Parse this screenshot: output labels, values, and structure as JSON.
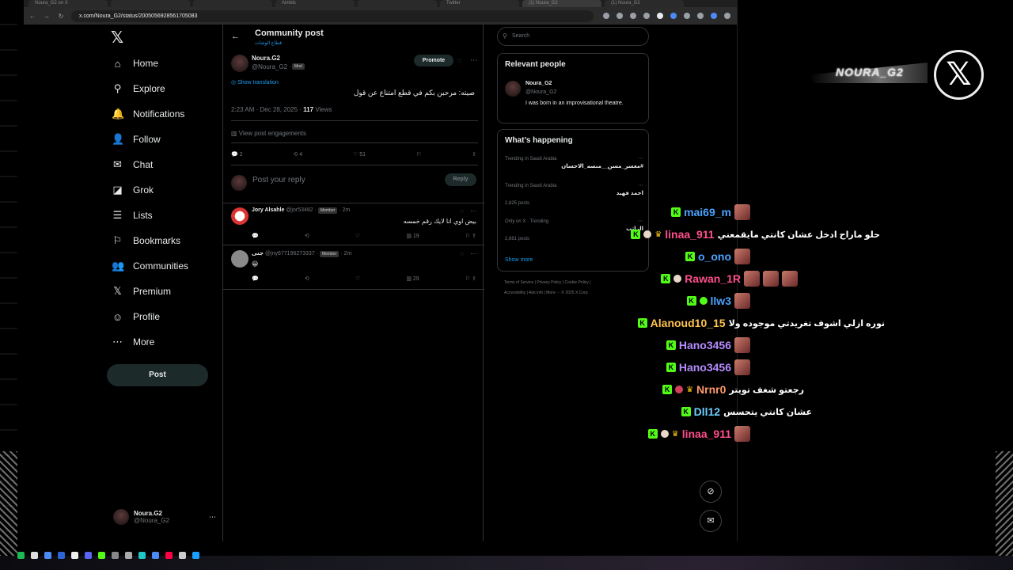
{
  "browser": {
    "tabs": [
      "Noura_G2 on X",
      "",
      "",
      "Aimblc",
      "",
      "Twitter",
      "(1) Noura_G2",
      "(1) Noura_G2"
    ],
    "url": "x.com/Noura_G2/status/2005056928561705083"
  },
  "nav": {
    "items": [
      {
        "label": "Home",
        "icon": "⌂",
        "name": "home"
      },
      {
        "label": "Explore",
        "icon": "⚲",
        "name": "explore"
      },
      {
        "label": "Notifications",
        "icon": "🔔",
        "name": "notifications"
      },
      {
        "label": "Follow",
        "icon": "👤",
        "name": "follow"
      },
      {
        "label": "Chat",
        "icon": "✉",
        "name": "chat"
      },
      {
        "label": "Grok",
        "icon": "◪",
        "name": "grok"
      },
      {
        "label": "Lists",
        "icon": "☰",
        "name": "lists"
      },
      {
        "label": "Bookmarks",
        "icon": "⚐",
        "name": "bookmarks"
      },
      {
        "label": "Communities",
        "icon": "👥",
        "name": "communities"
      },
      {
        "label": "Premium",
        "icon": "𝕏",
        "name": "premium"
      },
      {
        "label": "Profile",
        "icon": "☺",
        "name": "profile"
      },
      {
        "label": "More",
        "icon": "⋯",
        "name": "more"
      }
    ],
    "post_label": "Post",
    "account": {
      "name": "Noura.G2",
      "handle": "@Noura_G2"
    }
  },
  "main": {
    "title": "Community post",
    "subtitle": "قطاع الوشات",
    "post": {
      "author": "Noura.G2",
      "handle": "@Noura_G2 ·",
      "badge": "Mod",
      "promote": "Promote",
      "translate": "Show translation",
      "text": "صيته: مرحبن بكم في قطع امتناع عن قول",
      "time": "2:23 AM · Dec 28, 2025 ·",
      "views_count": "117",
      "views_label": "Views",
      "engagements": "View post engagements",
      "replies": "2",
      "reposts": "4",
      "likes": "51"
    },
    "reply_placeholder": "Post your reply",
    "reply_button": "Reply",
    "comments": [
      {
        "name": "Jory Alsahle",
        "handle": "@jor53482 ·",
        "badge": "Member",
        "time": "· 2m",
        "text": "بيض اوي انا لايك رقم خمسه",
        "views": "19"
      },
      {
        "name": "جنى",
        "handle": "@jny677196273337 ·",
        "badge": "Member",
        "time": "· 2m",
        "text": "😀",
        "views": "29"
      }
    ]
  },
  "sidebar": {
    "search_placeholder": "Search",
    "relevant_title": "Relevant people",
    "person": {
      "name": "Noura_G2",
      "handle": "@Noura_G2",
      "bio": "I was born in an improvisational theatre."
    },
    "happening_title": "What’s happening",
    "trends": [
      {
        "context": "Trending in Saudi Arabia",
        "name": "#معسر_مسن__منصه_الاحسان",
        "count": ""
      },
      {
        "context": "Trending in Saudi Arabia",
        "name": "احمد فهيد",
        "count": "2,825 posts"
      },
      {
        "context": "Only on X · Trending",
        "name": "الراتب",
        "count": "2,681 posts"
      }
    ],
    "show_more": "Show more",
    "footer": [
      "Terms of Service",
      "Privacy Policy",
      "Cookie Policy",
      "Accessibility",
      "Ads info",
      "More ···",
      "© 2025 X Corp."
    ]
  },
  "overlay": {
    "brand": "NOURA_G2",
    "chat": [
      {
        "user": "mai69_m",
        "color": "#4aa3ff",
        "msg": ""
      },
      {
        "user": "linaa_911",
        "color": "#ff4f8b",
        "msg": "حلو ماراح ادخل عشان كانتي مايقمعني"
      },
      {
        "user": "o_ono",
        "color": "#4aa3ff",
        "msg": ""
      },
      {
        "user": "Rawan_1R",
        "color": "#ff4f8b",
        "msg": ""
      },
      {
        "user": "llw3",
        "color": "#4aa3ff",
        "msg": ""
      },
      {
        "user": "Alanoud10_15",
        "color": "#ffc34d",
        "msg": "نوره ازلي اشوف تغريدتي موجوده ولا"
      },
      {
        "user": "Hano3456",
        "color": "#b58cff",
        "msg": ""
      },
      {
        "user": "Hano3456",
        "color": "#b58cff",
        "msg": ""
      },
      {
        "user": "Nrnr0",
        "color": "#ff9a6a",
        "msg": "رجعتو شغف تويتر"
      },
      {
        "user": "Dll12",
        "color": "#6fd0ff",
        "msg": "عشان كانتي يتحسس"
      },
      {
        "user": "linaa_911",
        "color": "#ff4f8b",
        "msg": ""
      }
    ]
  }
}
